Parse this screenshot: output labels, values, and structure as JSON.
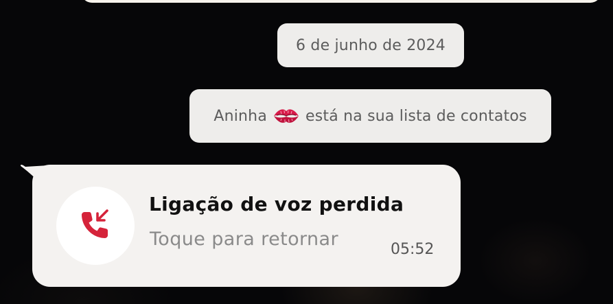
{
  "chat": {
    "date_label": "6 de junho de 2024",
    "contact_notice": {
      "name": "Aninha",
      "emoji": "💋",
      "emoji_icon": "kiss-mark-icon",
      "suffix": "está na sua lista de contatos"
    },
    "missed_call": {
      "title": "Ligação de voz perdida",
      "subtitle": "Toque para retornar",
      "time": "05:52",
      "icon": "missed-call-icon",
      "icon_color": "#d5233a"
    }
  }
}
